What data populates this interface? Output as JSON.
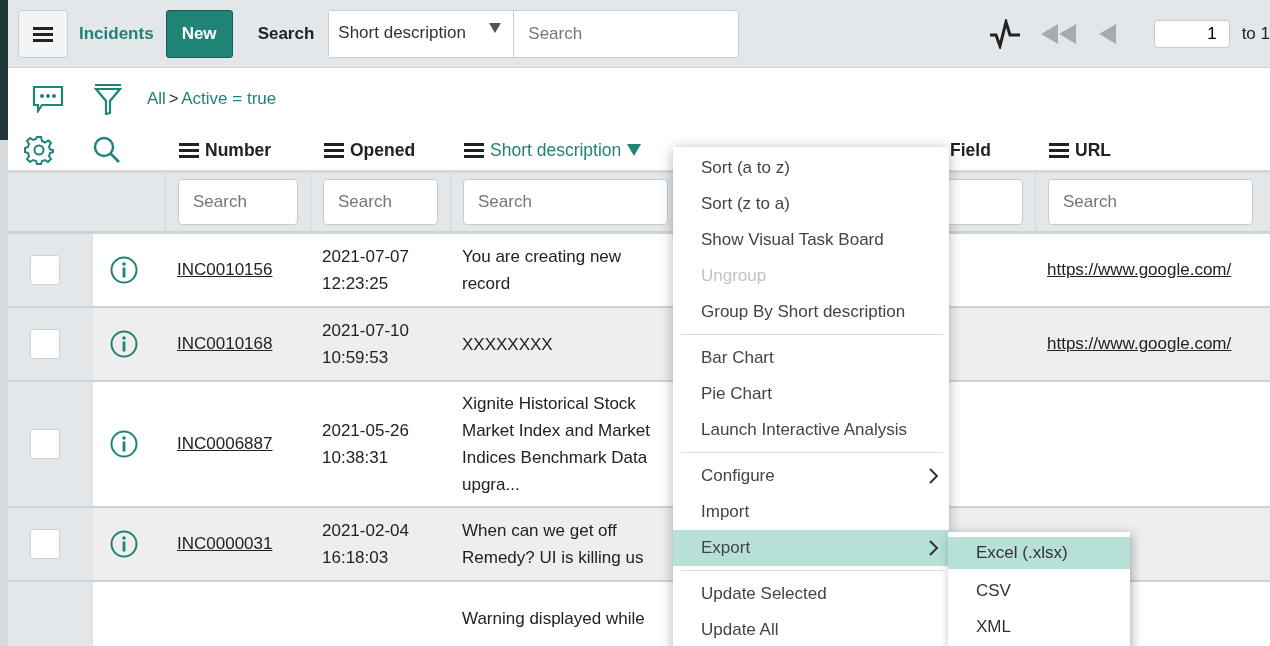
{
  "header": {
    "title": "Incidents",
    "new_button": "New",
    "search_label": "Search",
    "search_field": "Short description",
    "search_placeholder": "Search",
    "page": "1",
    "page_total": "to 1"
  },
  "breadcrumb": {
    "root": "All",
    "separator": ">",
    "filter": "Active = true"
  },
  "columns": [
    {
      "label": "Number",
      "sorted": false,
      "filter_placeholder": "Search"
    },
    {
      "label": "Opened",
      "sorted": false,
      "filter_placeholder": "Search"
    },
    {
      "label": "Short description",
      "sorted": true,
      "filter_placeholder": "Search"
    },
    {
      "kind": "hidden"
    },
    {
      "label": "Field",
      "sorted": false,
      "kind": "partial"
    },
    {
      "label": "URL",
      "sorted": false,
      "filter_placeholder": "Search"
    }
  ],
  "rows": [
    {
      "checked": false,
      "number": "INC0010156",
      "opened_date": "2021-07-07",
      "opened_time": "12:23:25",
      "short_description": "You are creating new record",
      "url": "https://www.google.com/"
    },
    {
      "checked": false,
      "number": "INC0010168",
      "opened_date": "2021-07-10",
      "opened_time": "10:59:53",
      "short_description": "XXXXXXXX",
      "url": "https://www.google.com/"
    },
    {
      "checked": false,
      "number": "INC0006887",
      "opened_date": "2021-05-26",
      "opened_time": "10:38:31",
      "short_description": "Xignite Historical Stock Market Index and Market Indices Benchmark Data upgra..."
    },
    {
      "checked": false,
      "number": "INC0000031",
      "opened_date": "2021-02-04",
      "opened_time": "16:18:03",
      "short_description": "When can we get off Remedy? UI is killing us"
    },
    {
      "short_description": "Warning displayed while"
    }
  ],
  "context_menu": {
    "groups": [
      [
        {
          "label": "Sort (a to z)",
          "disabled": false,
          "selected": false
        },
        {
          "label": "Sort (z to a)",
          "disabled": false,
          "selected": false
        },
        {
          "label": "Show Visual Task Board",
          "disabled": false,
          "selected": false
        },
        {
          "label": "Ungroup",
          "disabled": true,
          "selected": false
        },
        {
          "label": "Group By Short description",
          "disabled": false,
          "selected": false
        }
      ],
      [
        {
          "label": "Bar Chart",
          "disabled": false,
          "selected": false
        },
        {
          "label": "Pie Chart",
          "disabled": false,
          "selected": false
        },
        {
          "label": "Launch Interactive Analysis",
          "disabled": false,
          "selected": false
        }
      ],
      [
        {
          "label": "Configure",
          "disabled": false,
          "selected": false,
          "submenu": true
        },
        {
          "label": "Import",
          "disabled": false,
          "selected": false
        },
        {
          "label": "Export",
          "disabled": false,
          "selected": true,
          "submenu": true
        }
      ],
      [
        {
          "label": "Update Selected",
          "disabled": false,
          "selected": false
        },
        {
          "label": "Update All",
          "disabled": false,
          "selected": false
        }
      ]
    ]
  },
  "submenu": [
    {
      "label": "Excel (.xlsx)",
      "selected": true
    },
    {
      "label": "CSV",
      "selected": false
    },
    {
      "label": "XML",
      "selected": false
    }
  ]
}
